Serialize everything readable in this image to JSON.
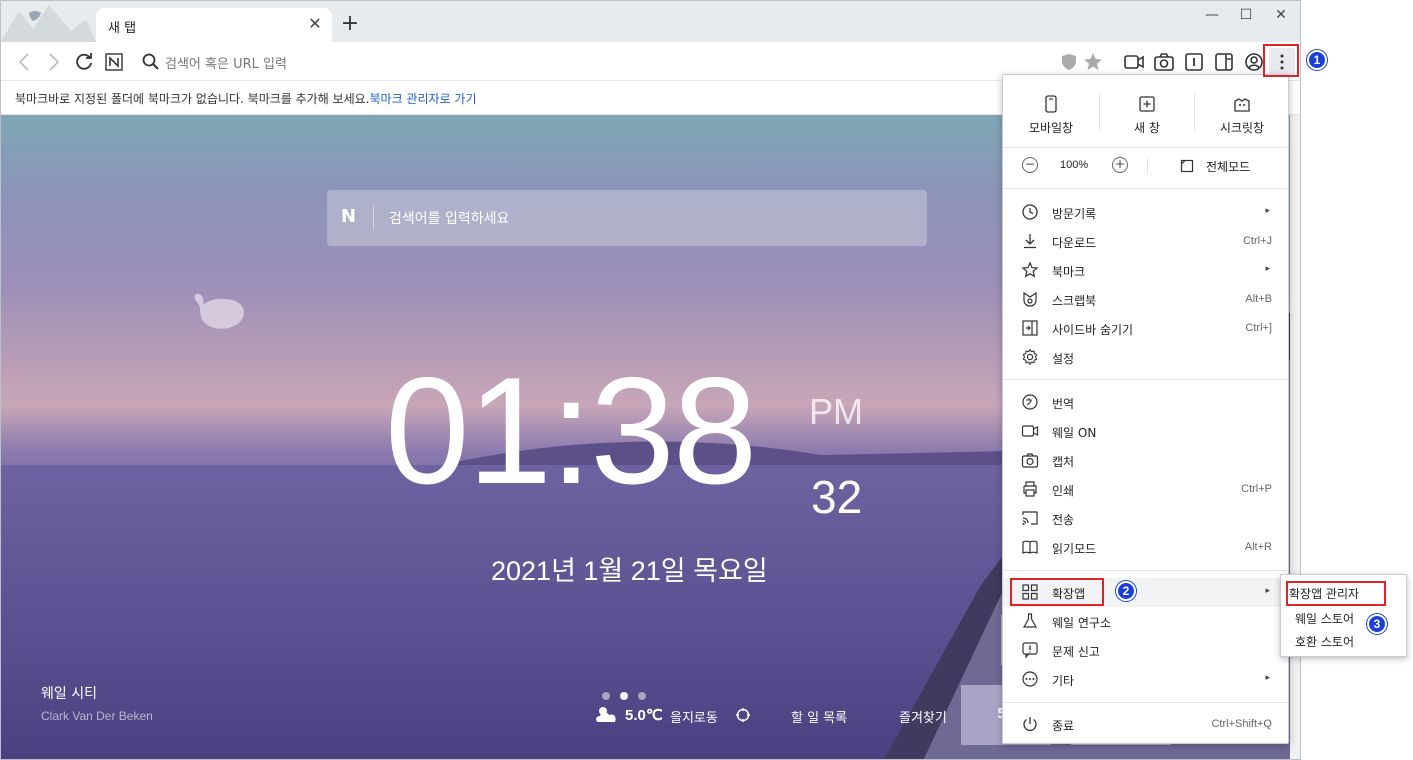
{
  "tab": {
    "title": "새 탭"
  },
  "toolbar": {
    "url_placeholder": "검색어 혹은 URL 입력"
  },
  "bookmark_bar": {
    "message": "북마크바로 지정된 폴더에 북마크가 없습니다. 북마크를 추가해 보세요.",
    "link": "북마크 관리자로 가기"
  },
  "newtab": {
    "search_placeholder": "검색어를 입력하세요",
    "clock": {
      "time": "01:38",
      "ampm": "PM",
      "seconds": "32"
    },
    "date": "2021년 1월 21일 목요일",
    "city": "웨일 시티",
    "credit": "Clark Van Der Beken",
    "weather": {
      "temp": "5.0℃",
      "location": "을지로동"
    },
    "todo": "할 일 목록",
    "favorites": "즐겨찾기",
    "partial": "5"
  },
  "menu": {
    "top": {
      "mobile": "모바일창",
      "new_window": "새 창",
      "secret": "시크릿창"
    },
    "zoom": {
      "minus": "−",
      "value": "100%",
      "plus": "+",
      "fullscreen": "전체모드"
    },
    "items1": [
      {
        "label": "방문기록",
        "shortcut": "",
        "arrow": "▸"
      },
      {
        "label": "다운로드",
        "shortcut": "Ctrl+J",
        "arrow": ""
      },
      {
        "label": "북마크",
        "shortcut": "",
        "arrow": "▸"
      },
      {
        "label": "스크랩북",
        "shortcut": "Alt+B",
        "arrow": ""
      },
      {
        "label": "사이드바 숨기기",
        "shortcut": "Ctrl+]",
        "arrow": ""
      },
      {
        "label": "설정",
        "shortcut": "",
        "arrow": ""
      }
    ],
    "items2": [
      {
        "label": "번역",
        "shortcut": ""
      },
      {
        "label": "웨일 ON",
        "shortcut": ""
      },
      {
        "label": "캡처",
        "shortcut": ""
      },
      {
        "label": "인쇄",
        "shortcut": "Ctrl+P"
      },
      {
        "label": "전송",
        "shortcut": ""
      },
      {
        "label": "읽기모드",
        "shortcut": "Alt+R"
      }
    ],
    "items3": [
      {
        "label": "확장앱",
        "arrow": "▸"
      },
      {
        "label": "웨일 연구소",
        "arrow": ""
      },
      {
        "label": "문제 신고",
        "arrow": ""
      },
      {
        "label": "기타",
        "arrow": "▸"
      }
    ],
    "exit": {
      "label": "종료",
      "shortcut": "Ctrl+Shift+Q"
    }
  },
  "submenu": {
    "items": [
      "확장앱 관리자",
      "웨일 스토어",
      "호환 스토어"
    ]
  },
  "annotations": {
    "badge1": "1",
    "badge2": "2",
    "badge3": "3"
  },
  "colors": {
    "annotation_red": "#e0222a",
    "annotation_blue": "#1b3fd8",
    "link_blue": "#1a5fd0"
  }
}
